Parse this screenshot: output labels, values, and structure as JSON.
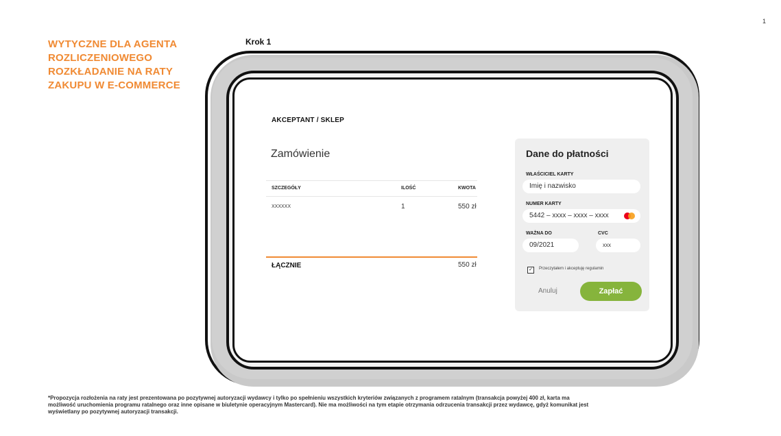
{
  "page_number": "1",
  "side_title": {
    "lines": [
      "WYTYCZNE DLA AGENTA",
      "ROZLICZENIOWEGO",
      "ROZKŁADANIE NA RATY",
      "ZAKUPU W E-COMMERCE"
    ]
  },
  "step_label": "Krok 1",
  "merchant_label": "AKCEPTANT / SKLEP",
  "order": {
    "title": "Zamówienie",
    "columns": [
      "SZCZEGÓŁY",
      "ILOŚĆ",
      "KWOTA"
    ],
    "rows": [
      {
        "detail": "XXXXXX",
        "qty": "1",
        "amount": "550 zł"
      }
    ],
    "total_label": "ŁĄCZNIE",
    "total_amount": "550 zł"
  },
  "payment": {
    "title": "Dane do płatności",
    "owner_label": "WŁAŚCICIEL KARTY",
    "owner_value": "Imię i nazwisko",
    "card_label": "NUMER KARTY",
    "card_value": "5442 – xxxx – xxxx – xxxx",
    "card_icon": "mastercard-icon",
    "expiry_label": "WAŻNA DO",
    "expiry_value": "09/2021",
    "cvc_label": "CVC",
    "cvc_value": "xxx",
    "terms_label": "Przeczytałem i akceptuję regulamin",
    "terms_checked": "✓",
    "cancel_label": "Anuluj",
    "pay_label": "Zapłać",
    "pay_color": "#86b43c"
  },
  "accent_color": "#f08a33",
  "footnote": {
    "lines": [
      "*Propozycja rozłożenia na raty jest prezentowana po pozytywnej autoryzacji wydawcy i tylko po spełnieniu wszystkich kryteriów związanych z programem ratalnym (transakcja powyżej 400 zł, karta ma",
      "możliwość uruchomienia programu ratalnego oraz inne opisane w biuletynie operacyjnym Mastercard). Nie ma możliwości na tym etapie otrzymania odrzucenia transakcji przez wydawcę, gdyż komunikat jest",
      "wyświetlany po pozytywnej autoryzacji transakcji."
    ]
  }
}
